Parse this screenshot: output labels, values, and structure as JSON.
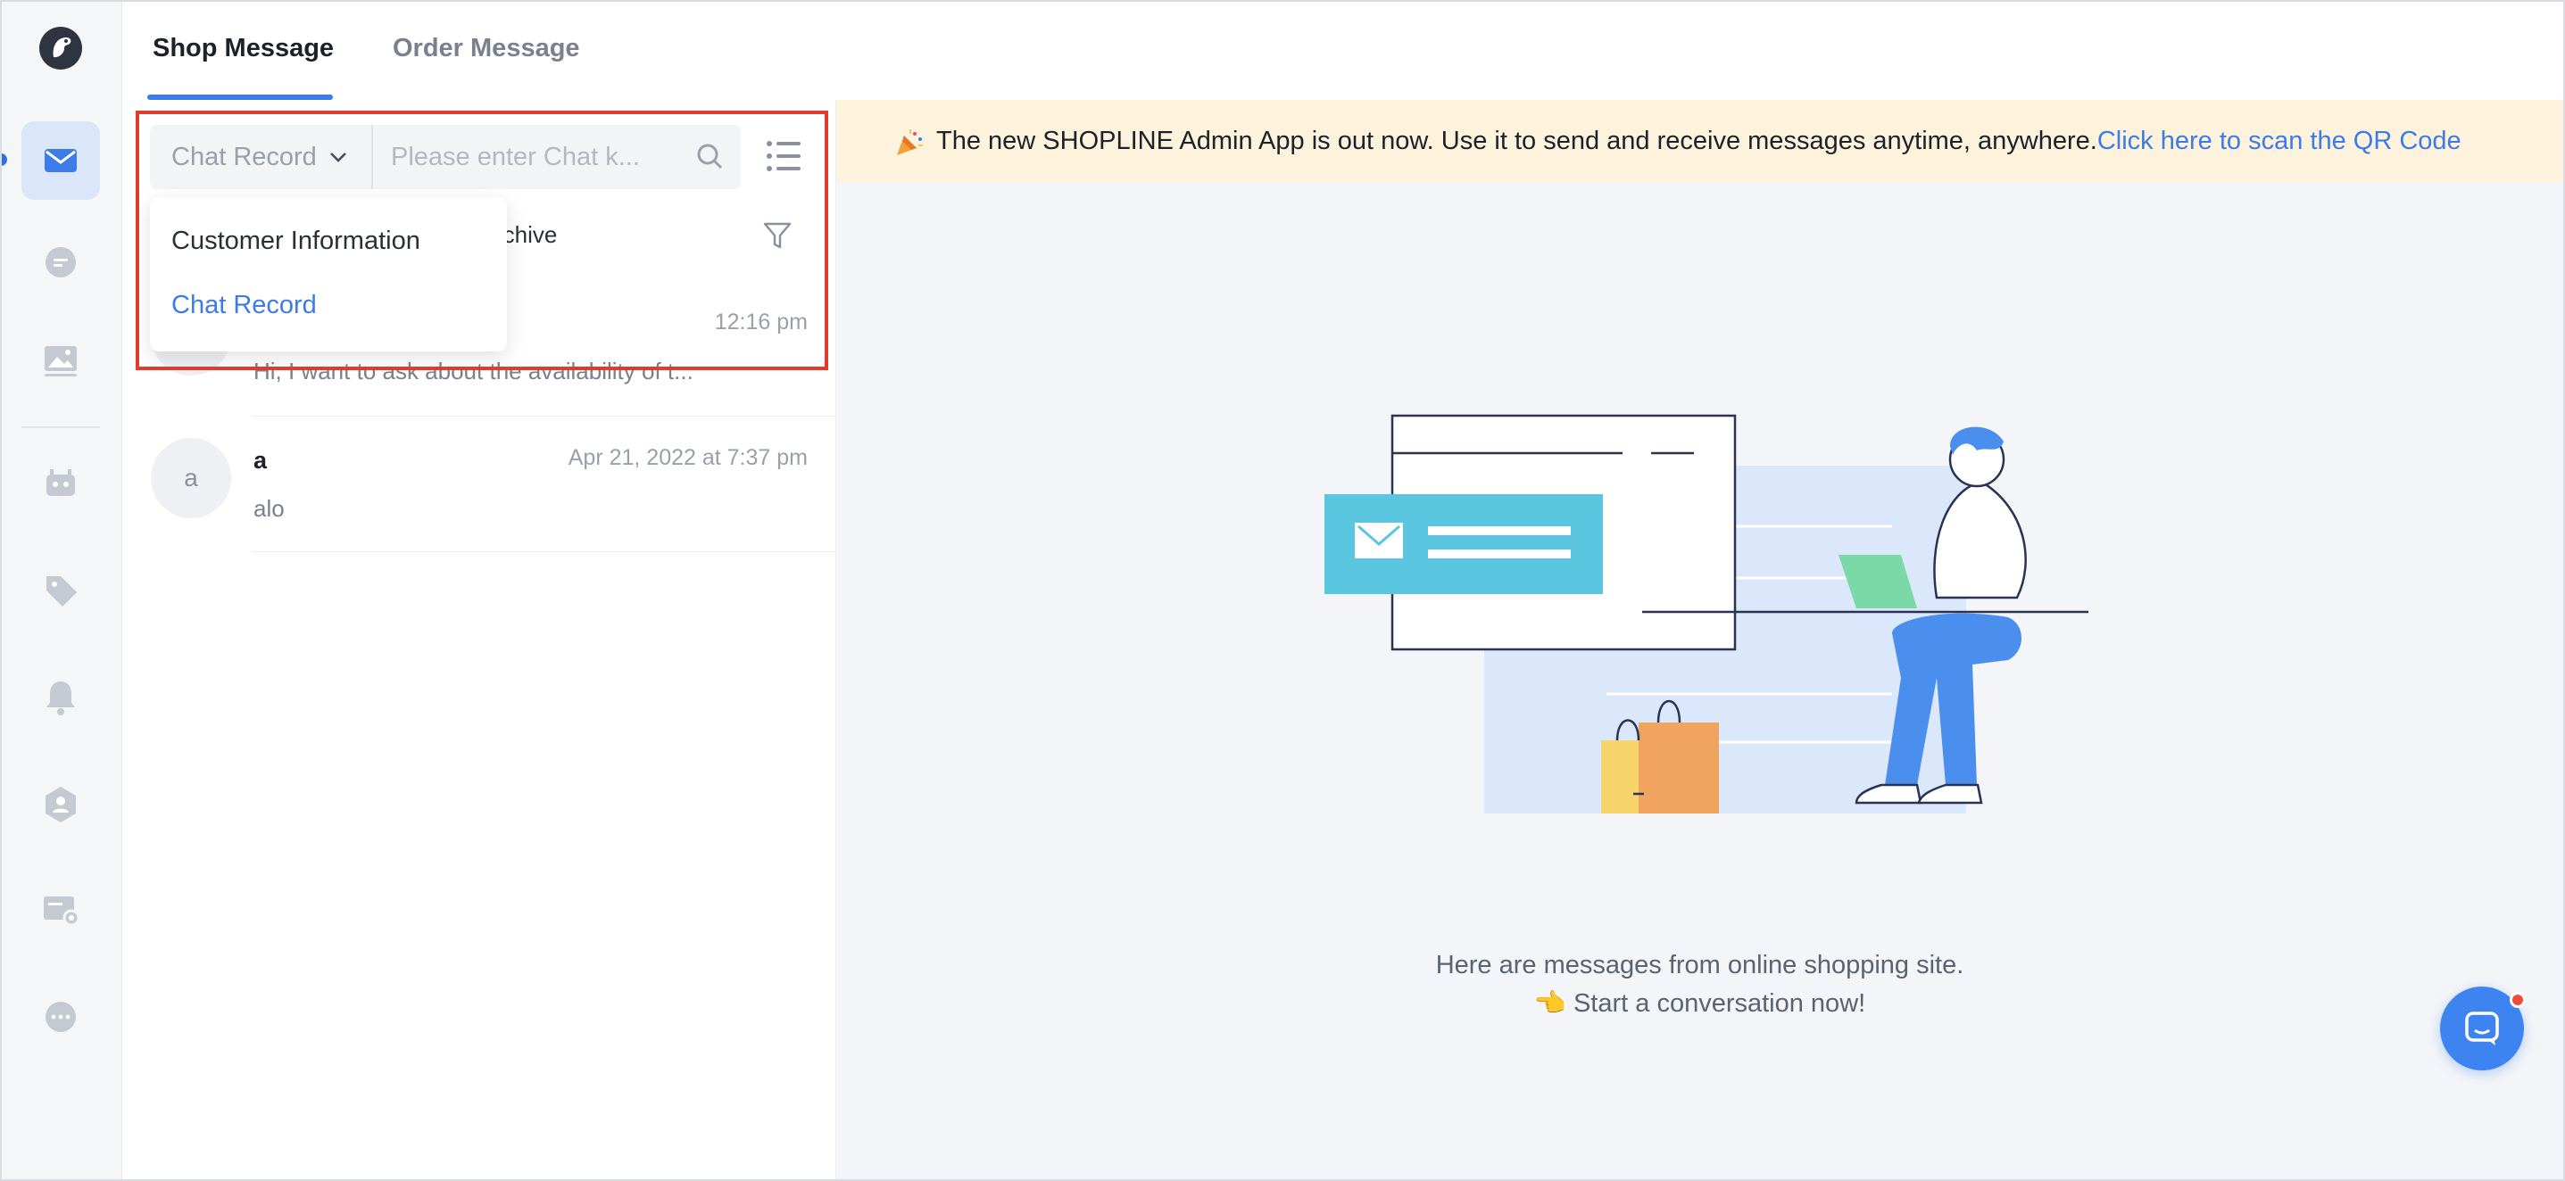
{
  "tabs": [
    {
      "label": "Shop Message",
      "active": true
    },
    {
      "label": "Order Message",
      "active": false
    }
  ],
  "search": {
    "type_label": "Chat Record",
    "placeholder": "Please enter Chat k..."
  },
  "dropdown": {
    "options": [
      "Customer Information",
      "Chat Record"
    ],
    "selected": "Chat Record"
  },
  "archive_label": "rchive",
  "conversations": [
    {
      "avatar": "",
      "name": "",
      "time": "12:16 pm",
      "preview": "Hi, I want to ask about the availability of t..."
    },
    {
      "avatar": "a",
      "name": "a",
      "time": "Apr 21, 2022 at 7:37 pm",
      "preview": "alo"
    }
  ],
  "banner": {
    "text": "The new SHOPLINE Admin App is out now. Use it to send and receive messages anytime, anywhere.",
    "link": "Click here to scan the QR Code"
  },
  "empty_state": {
    "line1": "Here are messages from online shopping site.",
    "line2": "👈 Start a conversation now!"
  },
  "rail_icons": [
    "logo-icon",
    "mail-icon",
    "chat-icon",
    "gallery-icon",
    "robot-icon",
    "tag-icon",
    "bell-icon",
    "contact-icon",
    "card-settings-icon",
    "more-icon"
  ],
  "colors": {
    "accent": "#3d7be8",
    "banner_bg": "#fdf2dc",
    "highlight": "#e03b2c"
  }
}
